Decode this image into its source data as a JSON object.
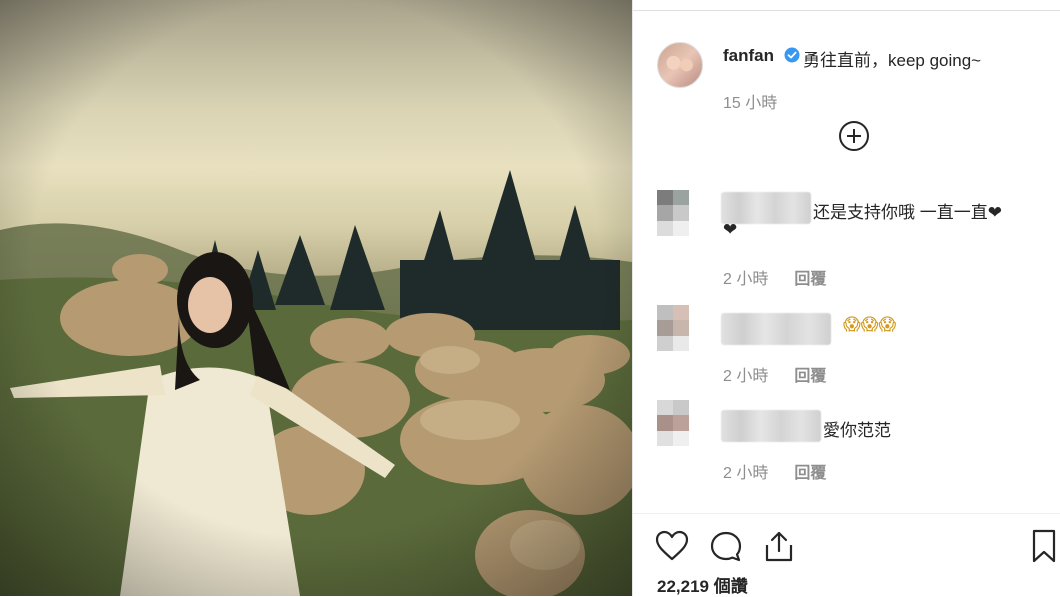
{
  "post": {
    "username": "fanfan",
    "verified": true,
    "caption": "勇往直前，keep going~",
    "time": "15 小時"
  },
  "comments": [
    {
      "username": "",
      "text": "还是支持你哦 一直一直❤",
      "text_wrap": "❤",
      "time": "2 小時",
      "reply_label": "回覆"
    },
    {
      "username": "",
      "text": "😱😱😱",
      "time": "2 小時",
      "reply_label": "回覆"
    },
    {
      "username": "",
      "text": "愛你范范",
      "time": "2 小時",
      "reply_label": "回覆"
    }
  ],
  "actions": {
    "like_icon": "heart-icon",
    "comment_icon": "speech-bubble-icon",
    "share_icon": "share-icon",
    "save_icon": "bookmark-icon"
  },
  "likes_text": "22,219 個讚",
  "colors": {
    "text": "#262626",
    "muted": "#8e8e8e",
    "verified": "#3897f0"
  }
}
